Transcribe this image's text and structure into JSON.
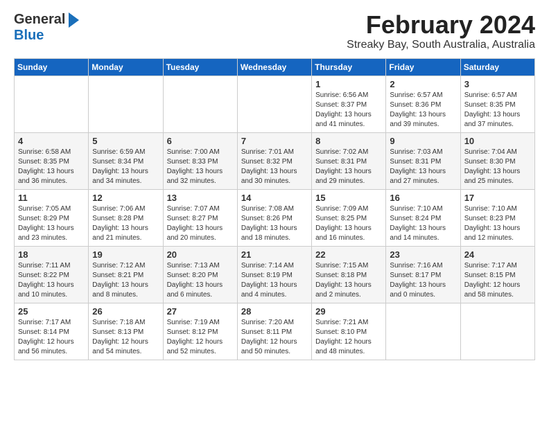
{
  "logo": {
    "line1": "General",
    "line2": "Blue"
  },
  "title": "February 2024",
  "location": "Streaky Bay, South Australia, Australia",
  "days_of_week": [
    "Sunday",
    "Monday",
    "Tuesday",
    "Wednesday",
    "Thursday",
    "Friday",
    "Saturday"
  ],
  "weeks": [
    [
      {
        "day": "",
        "info": ""
      },
      {
        "day": "",
        "info": ""
      },
      {
        "day": "",
        "info": ""
      },
      {
        "day": "",
        "info": ""
      },
      {
        "day": "1",
        "info": "Sunrise: 6:56 AM\nSunset: 8:37 PM\nDaylight: 13 hours\nand 41 minutes."
      },
      {
        "day": "2",
        "info": "Sunrise: 6:57 AM\nSunset: 8:36 PM\nDaylight: 13 hours\nand 39 minutes."
      },
      {
        "day": "3",
        "info": "Sunrise: 6:57 AM\nSunset: 8:35 PM\nDaylight: 13 hours\nand 37 minutes."
      }
    ],
    [
      {
        "day": "4",
        "info": "Sunrise: 6:58 AM\nSunset: 8:35 PM\nDaylight: 13 hours\nand 36 minutes."
      },
      {
        "day": "5",
        "info": "Sunrise: 6:59 AM\nSunset: 8:34 PM\nDaylight: 13 hours\nand 34 minutes."
      },
      {
        "day": "6",
        "info": "Sunrise: 7:00 AM\nSunset: 8:33 PM\nDaylight: 13 hours\nand 32 minutes."
      },
      {
        "day": "7",
        "info": "Sunrise: 7:01 AM\nSunset: 8:32 PM\nDaylight: 13 hours\nand 30 minutes."
      },
      {
        "day": "8",
        "info": "Sunrise: 7:02 AM\nSunset: 8:31 PM\nDaylight: 13 hours\nand 29 minutes."
      },
      {
        "day": "9",
        "info": "Sunrise: 7:03 AM\nSunset: 8:31 PM\nDaylight: 13 hours\nand 27 minutes."
      },
      {
        "day": "10",
        "info": "Sunrise: 7:04 AM\nSunset: 8:30 PM\nDaylight: 13 hours\nand 25 minutes."
      }
    ],
    [
      {
        "day": "11",
        "info": "Sunrise: 7:05 AM\nSunset: 8:29 PM\nDaylight: 13 hours\nand 23 minutes."
      },
      {
        "day": "12",
        "info": "Sunrise: 7:06 AM\nSunset: 8:28 PM\nDaylight: 13 hours\nand 21 minutes."
      },
      {
        "day": "13",
        "info": "Sunrise: 7:07 AM\nSunset: 8:27 PM\nDaylight: 13 hours\nand 20 minutes."
      },
      {
        "day": "14",
        "info": "Sunrise: 7:08 AM\nSunset: 8:26 PM\nDaylight: 13 hours\nand 18 minutes."
      },
      {
        "day": "15",
        "info": "Sunrise: 7:09 AM\nSunset: 8:25 PM\nDaylight: 13 hours\nand 16 minutes."
      },
      {
        "day": "16",
        "info": "Sunrise: 7:10 AM\nSunset: 8:24 PM\nDaylight: 13 hours\nand 14 minutes."
      },
      {
        "day": "17",
        "info": "Sunrise: 7:10 AM\nSunset: 8:23 PM\nDaylight: 13 hours\nand 12 minutes."
      }
    ],
    [
      {
        "day": "18",
        "info": "Sunrise: 7:11 AM\nSunset: 8:22 PM\nDaylight: 13 hours\nand 10 minutes."
      },
      {
        "day": "19",
        "info": "Sunrise: 7:12 AM\nSunset: 8:21 PM\nDaylight: 13 hours\nand 8 minutes."
      },
      {
        "day": "20",
        "info": "Sunrise: 7:13 AM\nSunset: 8:20 PM\nDaylight: 13 hours\nand 6 minutes."
      },
      {
        "day": "21",
        "info": "Sunrise: 7:14 AM\nSunset: 8:19 PM\nDaylight: 13 hours\nand 4 minutes."
      },
      {
        "day": "22",
        "info": "Sunrise: 7:15 AM\nSunset: 8:18 PM\nDaylight: 13 hours\nand 2 minutes."
      },
      {
        "day": "23",
        "info": "Sunrise: 7:16 AM\nSunset: 8:17 PM\nDaylight: 13 hours\nand 0 minutes."
      },
      {
        "day": "24",
        "info": "Sunrise: 7:17 AM\nSunset: 8:15 PM\nDaylight: 12 hours\nand 58 minutes."
      }
    ],
    [
      {
        "day": "25",
        "info": "Sunrise: 7:17 AM\nSunset: 8:14 PM\nDaylight: 12 hours\nand 56 minutes."
      },
      {
        "day": "26",
        "info": "Sunrise: 7:18 AM\nSunset: 8:13 PM\nDaylight: 12 hours\nand 54 minutes."
      },
      {
        "day": "27",
        "info": "Sunrise: 7:19 AM\nSunset: 8:12 PM\nDaylight: 12 hours\nand 52 minutes."
      },
      {
        "day": "28",
        "info": "Sunrise: 7:20 AM\nSunset: 8:11 PM\nDaylight: 12 hours\nand 50 minutes."
      },
      {
        "day": "29",
        "info": "Sunrise: 7:21 AM\nSunset: 8:10 PM\nDaylight: 12 hours\nand 48 minutes."
      },
      {
        "day": "",
        "info": ""
      },
      {
        "day": "",
        "info": ""
      }
    ]
  ]
}
